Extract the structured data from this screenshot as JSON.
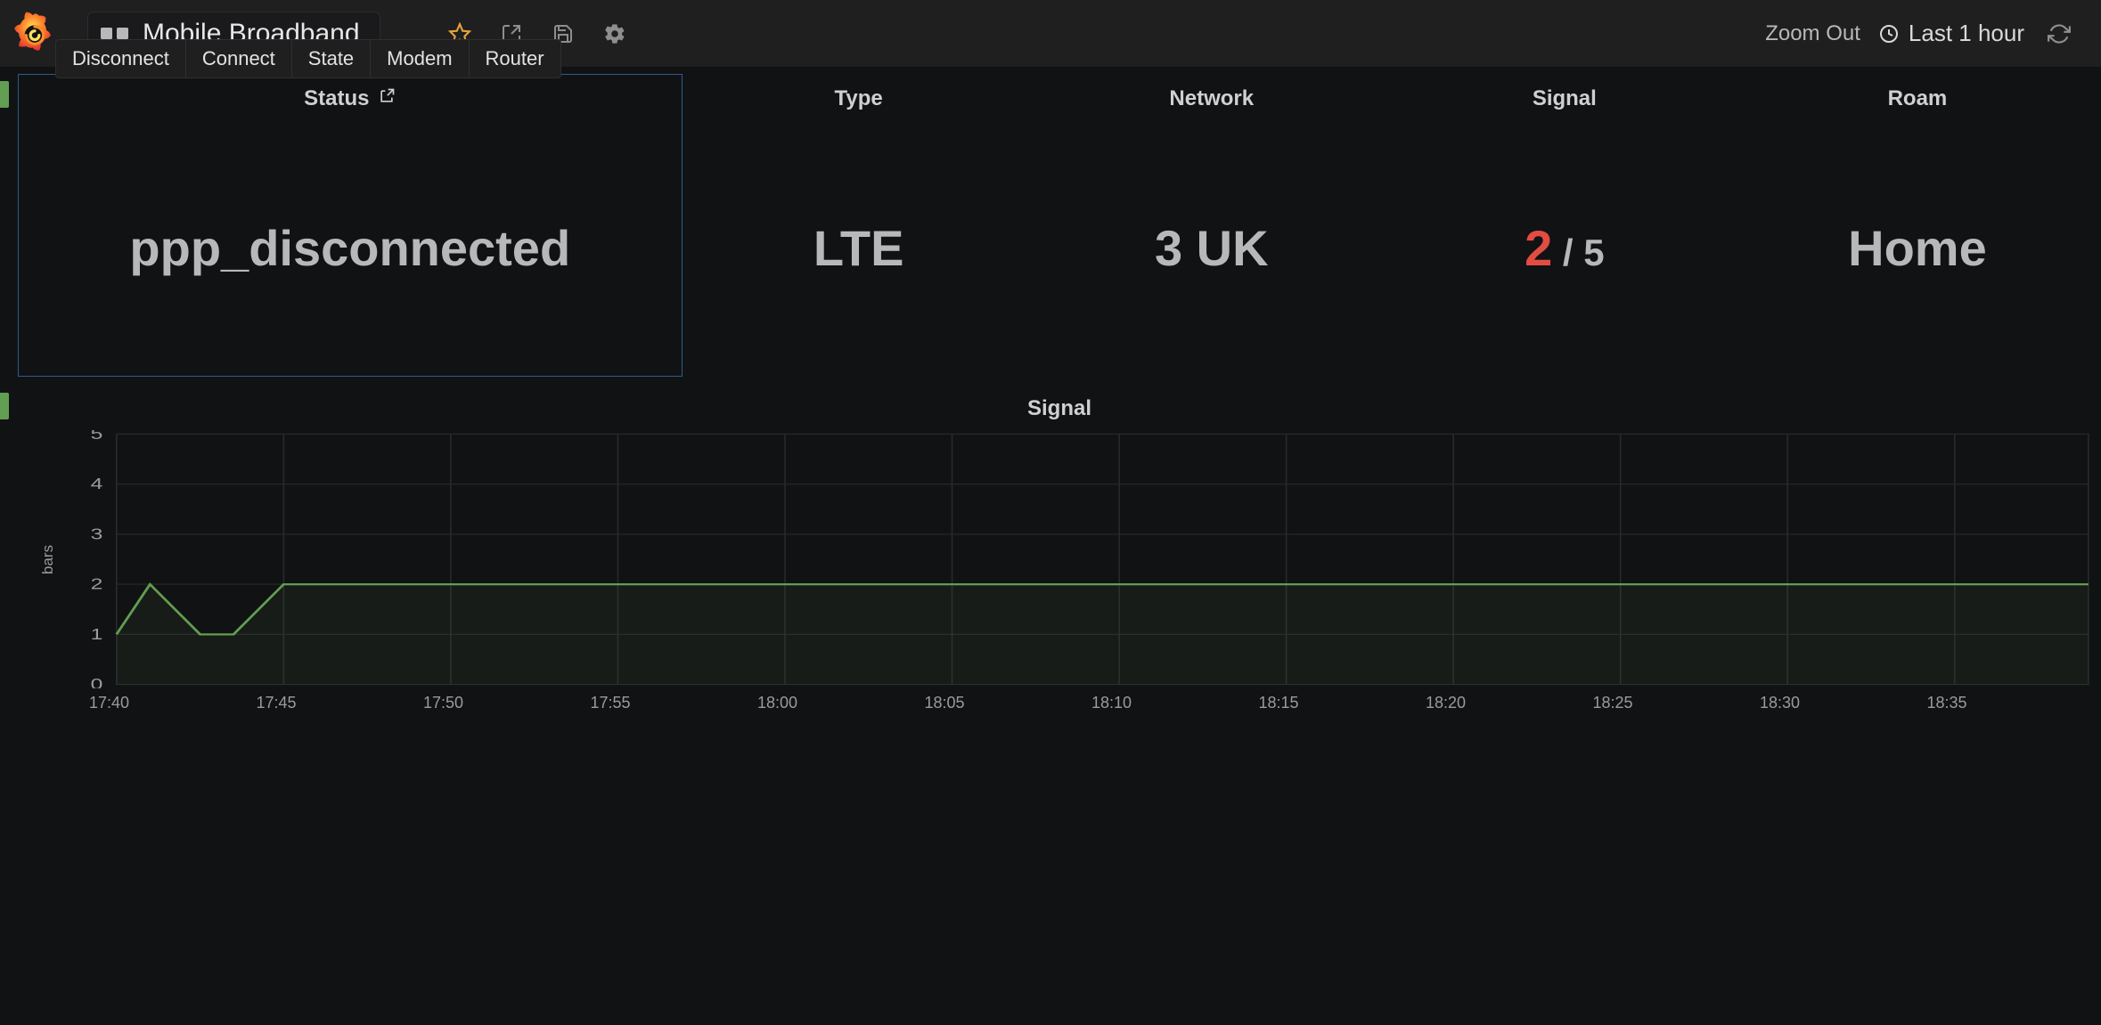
{
  "header": {
    "dashboard_title": "Mobile Broadband",
    "zoom_out": "Zoom Out",
    "time_range": "Last 1 hour"
  },
  "actions": {
    "disconnect": "Disconnect",
    "connect": "Connect",
    "state": "State",
    "modem": "Modem",
    "router": "Router"
  },
  "panels": {
    "status": {
      "title": "Status",
      "value": "ppp_disconnected"
    },
    "type": {
      "title": "Type",
      "value": "LTE"
    },
    "network": {
      "title": "Network",
      "value": "3 UK"
    },
    "signal": {
      "title": "Signal",
      "value_num": "2",
      "value_suffix": " / 5"
    },
    "roam": {
      "title": "Roam",
      "value": "Home"
    }
  },
  "chart_data": {
    "type": "line",
    "title": "Signal",
    "ylabel": "bars",
    "ylim": [
      0,
      5
    ],
    "y_ticks": [
      0,
      1,
      2,
      3,
      4,
      5
    ],
    "x_ticks": [
      "17:40",
      "17:45",
      "17:50",
      "17:55",
      "18:00",
      "18:05",
      "18:10",
      "18:15",
      "18:20",
      "18:25",
      "18:30",
      "18:35"
    ],
    "series": [
      {
        "name": "bars",
        "color": "#629e51",
        "points": [
          {
            "x": "17:40",
            "y": 1
          },
          {
            "x": "17:41",
            "y": 2
          },
          {
            "x": "17:42.5",
            "y": 1
          },
          {
            "x": "17:43.5",
            "y": 1
          },
          {
            "x": "17:45",
            "y": 2
          },
          {
            "x": "18:39",
            "y": 2
          }
        ]
      }
    ]
  }
}
